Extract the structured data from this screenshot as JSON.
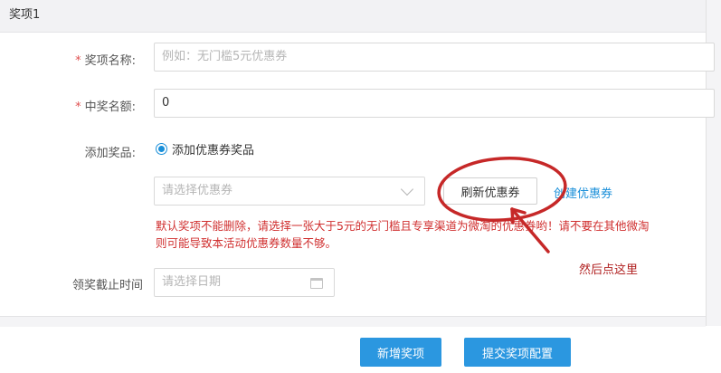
{
  "panel": {
    "title": "奖项1"
  },
  "form": {
    "prize_name": {
      "label": "奖项名称:",
      "required_mark": "*",
      "placeholder": "例如：无门槛5元优惠券"
    },
    "winner_quota": {
      "label": "中奖名额:",
      "required_mark": "*",
      "value": "0"
    },
    "add_prize": {
      "label": "添加奖品:",
      "radio_label": "添加优惠券奖品"
    },
    "coupon_select": {
      "placeholder": "请选择优惠券"
    },
    "refresh_button": "刷新优惠券",
    "create_link": "创建优惠券",
    "warning_line1": "默认奖项不能删除，请选择一张大于5元的无门槛且专享渠道为微淘的优惠券哟！请不要在其他微淘",
    "warning_line2": "则可能导致本活动优惠券数量不够。",
    "deadline": {
      "label": "领奖截止时间",
      "placeholder": "请选择日期"
    }
  },
  "footer": {
    "add_prize_button": "新增奖项",
    "submit_button": "提交奖项配置"
  },
  "annotation": {
    "text": "然后点这里",
    "color": "#b02020"
  },
  "colors": {
    "accent": "#2b97e0",
    "link": "#1a8fd9",
    "warning": "#d03030",
    "annotation_red": "#c62828"
  }
}
